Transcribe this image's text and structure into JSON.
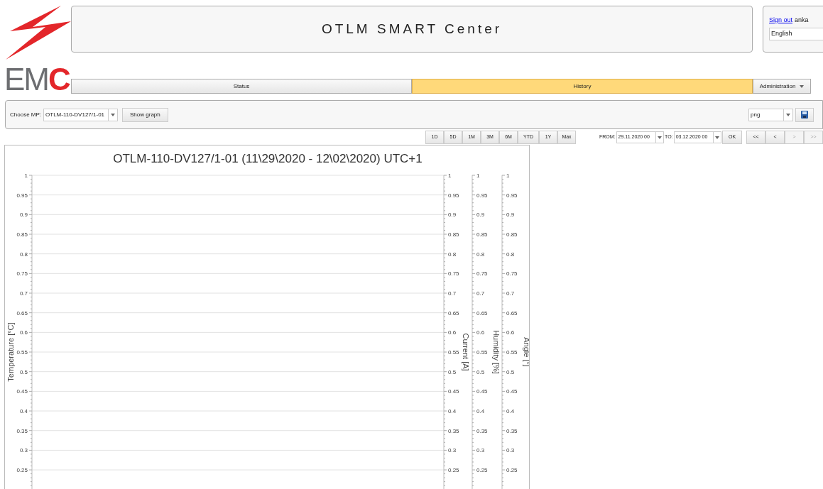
{
  "logo": {
    "parts": [
      {
        "text": "EM",
        "color": "#6d6e71"
      },
      {
        "text": "C",
        "color": "#e3262a"
      }
    ]
  },
  "header": {
    "title": "OTLM SMART Center"
  },
  "user": {
    "sign_out": "Sign out",
    "name": "anka",
    "language": "English"
  },
  "nav": [
    {
      "label": "Status",
      "selected": false,
      "kind": "tab"
    },
    {
      "label": "History",
      "selected": true,
      "kind": "tab"
    },
    {
      "label": "Administration",
      "selected": false,
      "kind": "menu"
    }
  ],
  "toolbar": {
    "mp_label": "Choose MP:",
    "mp_value": "OTLM-110-DV127/1-01",
    "show_graph": "Show graph",
    "format": "png"
  },
  "ranges": [
    {
      "label": "1D"
    },
    {
      "label": "5D"
    },
    {
      "label": "1M"
    },
    {
      "label": "3M"
    },
    {
      "label": "6M"
    },
    {
      "label": "YTD"
    },
    {
      "label": "1Y"
    },
    {
      "label": "Max"
    }
  ],
  "period": {
    "from_label": "FROM:",
    "from": "29.11.2020 00",
    "to_label": "TO:",
    "to": "03.12.2020 00",
    "ok": "OK"
  },
  "paging": [
    {
      "label": "<<",
      "disabled": false
    },
    {
      "label": "<",
      "disabled": false
    },
    {
      "label": ">",
      "disabled": true
    },
    {
      "label": ">>",
      "disabled": true
    }
  ],
  "chart": {
    "title": "OTLM-110-DV127/1-01 (11\\29\\2020 - 12\\02\\2020) UTC+1",
    "axes": [
      {
        "label": "Temperature [°C]",
        "kind": "left",
        "ticks": [
          "1",
          "0.95",
          "0.9",
          "0.85",
          "0.8",
          "0.75",
          "0.7",
          "0.65",
          "0.6",
          "0.55",
          "0.5",
          "0.45",
          "0.4",
          "0.35",
          "0.3",
          "0.25"
        ]
      },
      {
        "label": "Current [A]",
        "kind": "right",
        "ticks": [
          "1",
          "0.95",
          "0.9",
          "0.85",
          "0.8",
          "0.75",
          "0.7",
          "0.65",
          "0.6",
          "0.55",
          "0.5",
          "0.45",
          "0.4",
          "0.35",
          "0.3",
          "0.25"
        ]
      },
      {
        "label": "Humidity [%]",
        "kind": "right",
        "ticks": [
          "1",
          "0.95",
          "0.9",
          "0.85",
          "0.8",
          "0.75",
          "0.7",
          "0.65",
          "0.6",
          "0.55",
          "0.5",
          "0.45",
          "0.4",
          "0.35",
          "0.3",
          "0.25"
        ]
      },
      {
        "label": "Angle [°]",
        "kind": "right",
        "ticks": [
          "1",
          "0.95",
          "0.9",
          "0.85",
          "0.8",
          "0.75",
          "0.7",
          "0.65",
          "0.6",
          "0.55",
          "0.5",
          "0.45",
          "0.4",
          "0.35",
          "0.3",
          "0.25"
        ]
      }
    ]
  }
}
